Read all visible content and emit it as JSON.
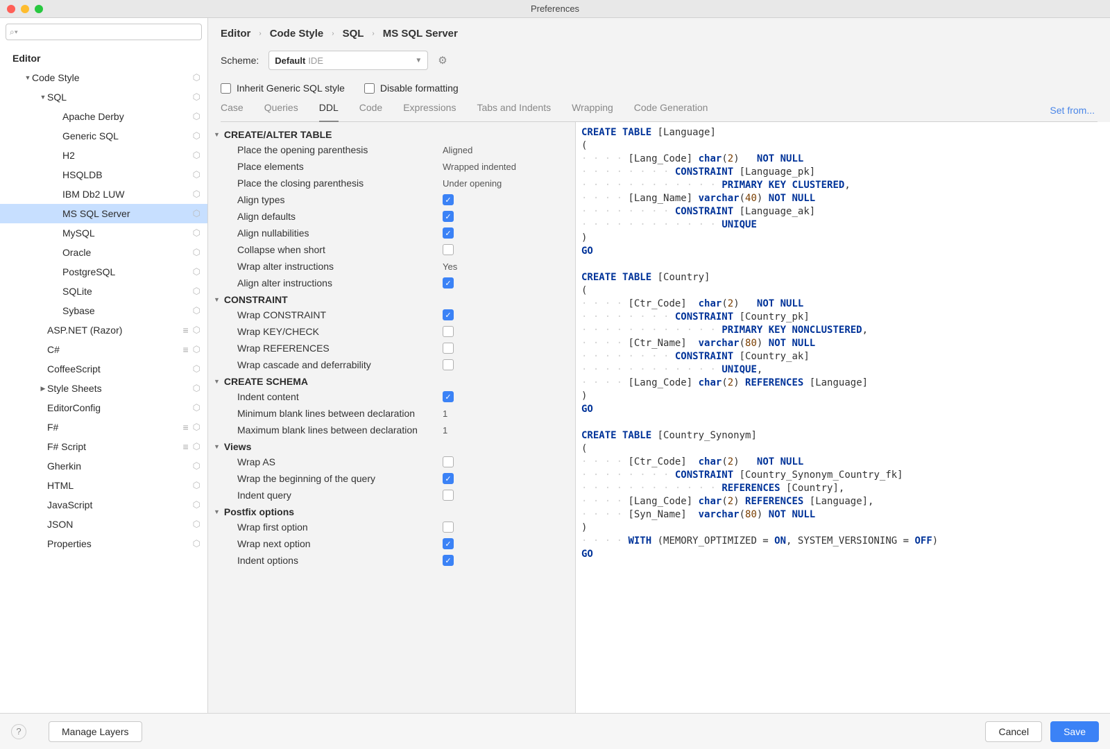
{
  "window": {
    "title": "Preferences"
  },
  "search": {
    "placeholder": ""
  },
  "sidebar_head": "Editor",
  "tree": [
    {
      "label": "Code Style",
      "depth": 1,
      "arrow": "▼",
      "dot": true,
      "bold": false
    },
    {
      "label": "SQL",
      "depth": 2,
      "arrow": "▼",
      "dot": true,
      "bold": false
    },
    {
      "label": "Apache Derby",
      "depth": 3,
      "arrow": "",
      "dot": true
    },
    {
      "label": "Generic SQL",
      "depth": 3,
      "arrow": "",
      "dot": true
    },
    {
      "label": "H2",
      "depth": 3,
      "arrow": "",
      "dot": true
    },
    {
      "label": "HSQLDB",
      "depth": 3,
      "arrow": "",
      "dot": true
    },
    {
      "label": "IBM Db2 LUW",
      "depth": 3,
      "arrow": "",
      "dot": true
    },
    {
      "label": "MS SQL Server",
      "depth": 3,
      "arrow": "",
      "dot": true,
      "sel": true
    },
    {
      "label": "MySQL",
      "depth": 3,
      "arrow": "",
      "dot": true
    },
    {
      "label": "Oracle",
      "depth": 3,
      "arrow": "",
      "dot": true
    },
    {
      "label": "PostgreSQL",
      "depth": 3,
      "arrow": "",
      "dot": true
    },
    {
      "label": "SQLite",
      "depth": 3,
      "arrow": "",
      "dot": true
    },
    {
      "label": "Sybase",
      "depth": 3,
      "arrow": "",
      "dot": true
    },
    {
      "label": "ASP.NET (Razor)",
      "depth": 2,
      "arrow": "",
      "dot": true,
      "stack": true
    },
    {
      "label": "C#",
      "depth": 2,
      "arrow": "",
      "dot": true,
      "stack": true
    },
    {
      "label": "CoffeeScript",
      "depth": 2,
      "arrow": "",
      "dot": true
    },
    {
      "label": "Style Sheets",
      "depth": 2,
      "arrow": "▶",
      "dot": true
    },
    {
      "label": "EditorConfig",
      "depth": 2,
      "arrow": "",
      "dot": true
    },
    {
      "label": "F#",
      "depth": 2,
      "arrow": "",
      "dot": true,
      "stack": true
    },
    {
      "label": "F# Script",
      "depth": 2,
      "arrow": "",
      "dot": true,
      "stack": true
    },
    {
      "label": "Gherkin",
      "depth": 2,
      "arrow": "",
      "dot": true
    },
    {
      "label": "HTML",
      "depth": 2,
      "arrow": "",
      "dot": true
    },
    {
      "label": "JavaScript",
      "depth": 2,
      "arrow": "",
      "dot": true
    },
    {
      "label": "JSON",
      "depth": 2,
      "arrow": "",
      "dot": true
    },
    {
      "label": "Properties",
      "depth": 2,
      "arrow": "",
      "dot": true
    }
  ],
  "breadcrumb": [
    "Editor",
    "Code Style",
    "SQL",
    "MS SQL Server"
  ],
  "scheme": {
    "label": "Scheme:",
    "name": "Default",
    "tag": "IDE"
  },
  "setfrom": "Set from...",
  "inherit": "Inherit Generic SQL style",
  "disablefmt": "Disable formatting",
  "tabs": [
    "Case",
    "Queries",
    "DDL",
    "Code",
    "Expressions",
    "Tabs and Indents",
    "Wrapping",
    "Code Generation"
  ],
  "active_tab": 2,
  "groups": [
    {
      "title": "CREATE/ALTER TABLE",
      "opts": [
        {
          "label": "Place the opening parenthesis",
          "val": "Aligned",
          "chk": null
        },
        {
          "label": "Place elements",
          "val": "Wrapped indented",
          "chk": null
        },
        {
          "label": "Place the closing parenthesis",
          "val": "Under opening",
          "chk": null
        },
        {
          "label": "Align types",
          "val": "",
          "chk": true
        },
        {
          "label": "Align defaults",
          "val": "",
          "chk": true
        },
        {
          "label": "Align nullabilities",
          "val": "",
          "chk": true
        },
        {
          "label": "Collapse when short",
          "val": "",
          "chk": false
        },
        {
          "label": "Wrap alter instructions",
          "val": "Yes",
          "chk": null
        },
        {
          "label": "Align alter instructions",
          "val": "",
          "chk": true
        }
      ]
    },
    {
      "title": "CONSTRAINT",
      "opts": [
        {
          "label": "Wrap CONSTRAINT",
          "val": "",
          "chk": true
        },
        {
          "label": "Wrap KEY/CHECK",
          "val": "",
          "chk": false
        },
        {
          "label": "Wrap REFERENCES",
          "val": "",
          "chk": false
        },
        {
          "label": "Wrap cascade and deferrability",
          "val": "",
          "chk": false
        }
      ]
    },
    {
      "title": "CREATE SCHEMA",
      "opts": [
        {
          "label": "Indent content",
          "val": "",
          "chk": true
        },
        {
          "label": "Minimum blank lines between declaration",
          "val": "1",
          "chk": null
        },
        {
          "label": "Maximum blank lines between declaration",
          "val": "1",
          "chk": null
        }
      ]
    },
    {
      "title": "Views",
      "opts": [
        {
          "label": "Wrap AS",
          "val": "",
          "chk": false
        },
        {
          "label": "Wrap the beginning of the query",
          "val": "",
          "chk": true
        },
        {
          "label": "Indent query",
          "val": "",
          "chk": false
        }
      ]
    },
    {
      "title": "Postfix options",
      "opts": [
        {
          "label": "Wrap first option",
          "val": "",
          "chk": false
        },
        {
          "label": "Wrap next option",
          "val": "",
          "chk": true
        },
        {
          "label": "Indent options",
          "val": "",
          "chk": true
        }
      ]
    }
  ],
  "footer": {
    "manage": "Manage Layers",
    "cancel": "Cancel",
    "save": "Save"
  }
}
